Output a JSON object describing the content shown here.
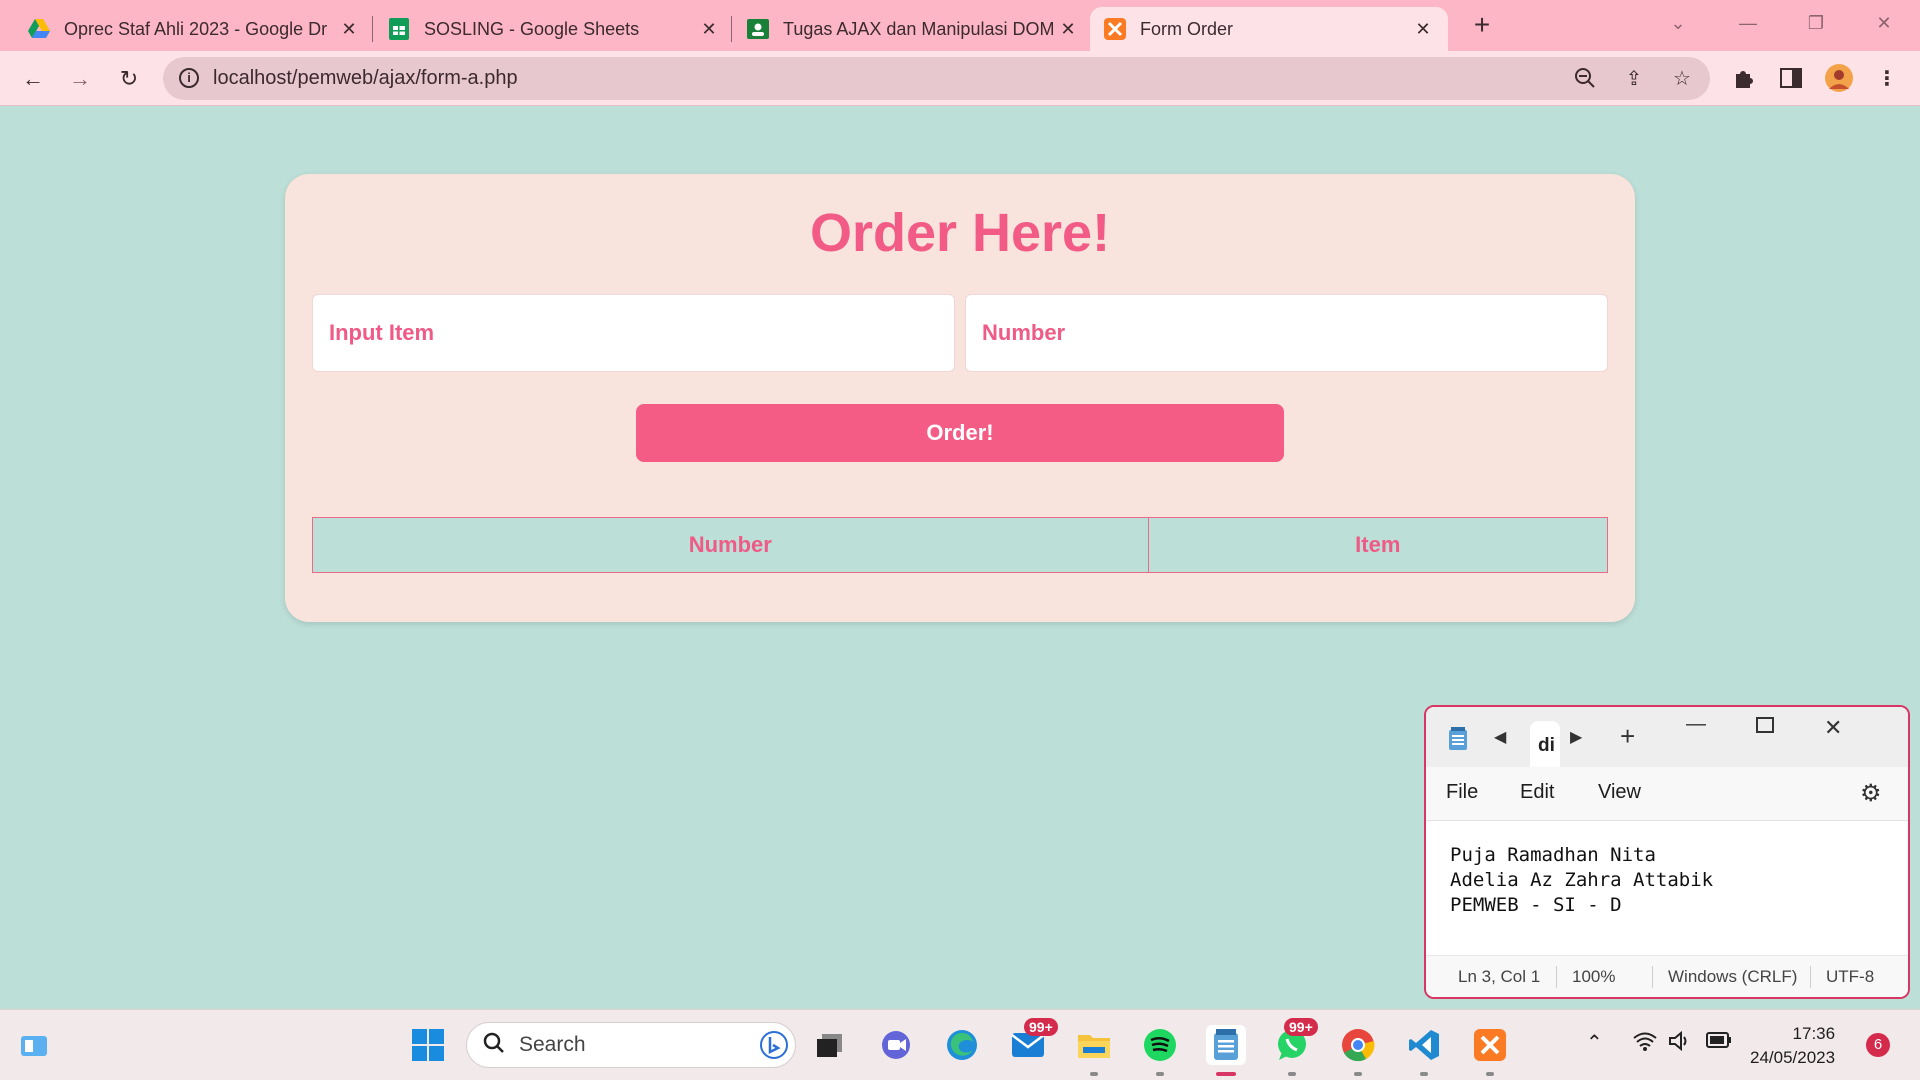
{
  "browser": {
    "tabs": [
      {
        "title": "Oprec Staf Ahli 2023 - Google Dr",
        "icon": "google-drive-icon"
      },
      {
        "title": "SOSLING - Google Sheets",
        "icon": "google-sheets-icon"
      },
      {
        "title": "Tugas AJAX dan Manipulasi DOM",
        "icon": "google-classroom-icon"
      },
      {
        "title": "Form Order",
        "icon": "xampp-icon",
        "active": true
      }
    ],
    "url": "localhost/pemweb/ajax/form-a.php"
  },
  "page": {
    "title": "Order Here!",
    "item_placeholder": "Input Item",
    "number_placeholder": "Number",
    "order_button": "Order!",
    "table_headers": [
      "Number",
      "Item"
    ]
  },
  "notepad": {
    "tab_title": "di",
    "menu": [
      "File",
      "Edit",
      "View"
    ],
    "lines": [
      "Puja Ramadhan Nita",
      "Adelia Az Zahra Attabik",
      "PEMWEB - SI - D"
    ],
    "status": {
      "position": "Ln 3, Col 1",
      "zoom": "100%",
      "line_ending": "Windows (CRLF)",
      "encoding": "UTF-8"
    }
  },
  "taskbar": {
    "search_label": "Search",
    "mail_badge": "99+",
    "whatsapp_badge": "99+",
    "time": "17:36",
    "date": "24/05/2023",
    "notification_count": "6"
  },
  "colors": {
    "accent": "#f45b85",
    "background": "#bcdfd8",
    "card": "#f9e3dd",
    "chrome": "#fcb6c6"
  }
}
